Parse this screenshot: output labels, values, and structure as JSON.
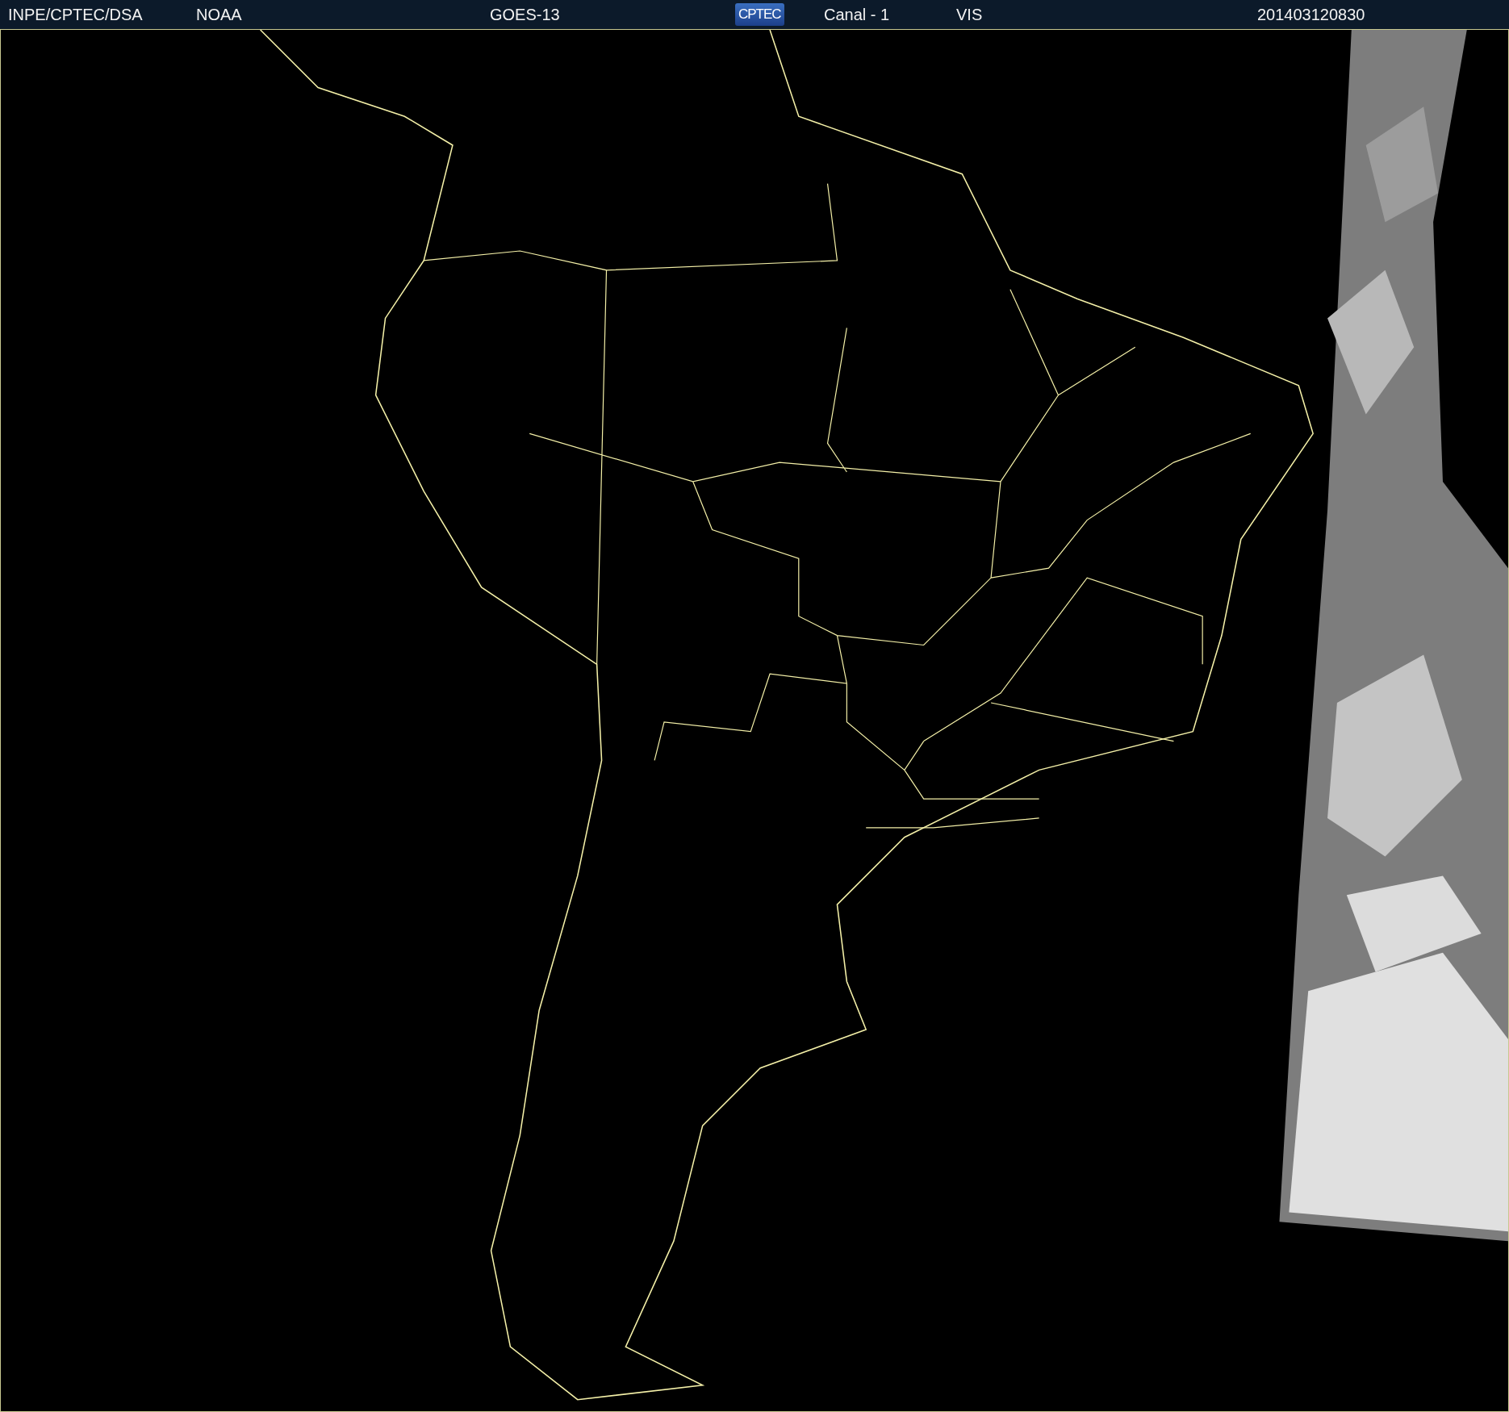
{
  "header": {
    "source": "INPE/CPTEC/DSA",
    "agency": "NOAA",
    "satellite": "GOES-13",
    "logo": "CPTEC",
    "channel": "Canal - 1",
    "band": "VIS",
    "timestamp": "201403120830"
  }
}
